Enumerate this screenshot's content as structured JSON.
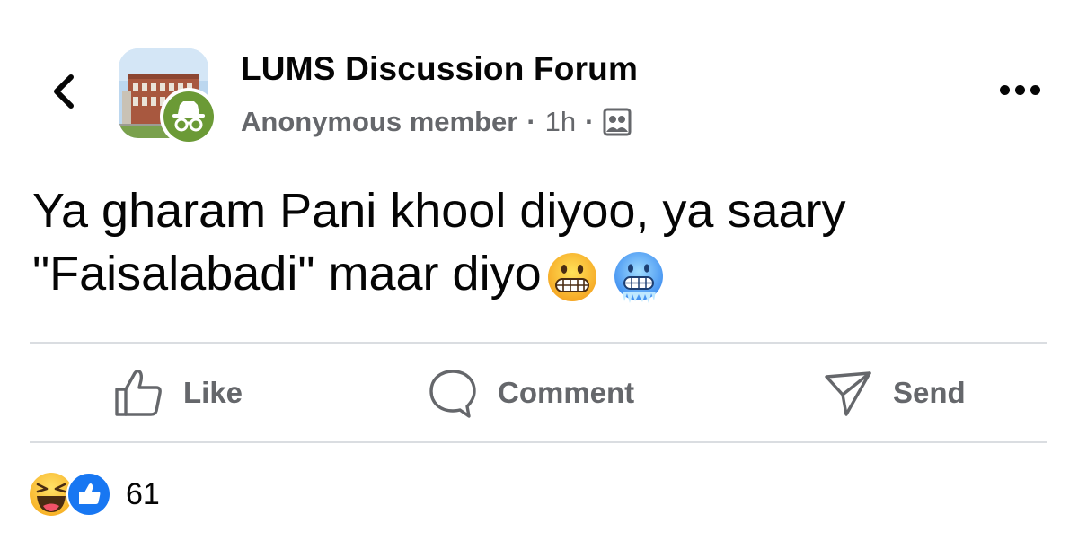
{
  "header": {
    "group_name": "LUMS Discussion Forum",
    "author": "Anonymous member",
    "separator": "·",
    "timestamp": "1h",
    "audience_icon": "group-members-icon",
    "back_icon": "chevron-left-icon",
    "more_icon": "more-horizontal-icon"
  },
  "post": {
    "line1": "Ya gharam Pani khool diyoo, ya saary",
    "line2": "\"Faisalabadi\" maar diyo",
    "emojis": [
      "grimacing-face-emoji",
      "cold-face-emoji"
    ]
  },
  "actions": {
    "like_label": "Like",
    "comment_label": "Comment",
    "send_label": "Send"
  },
  "reactions": {
    "types": [
      "haha",
      "like"
    ],
    "count": "61"
  },
  "colors": {
    "text_primary": "#050505",
    "text_secondary": "#65676b",
    "like_blue": "#1877f2",
    "anon_badge_green": "#6b9a36",
    "divider": "#dadde1"
  }
}
